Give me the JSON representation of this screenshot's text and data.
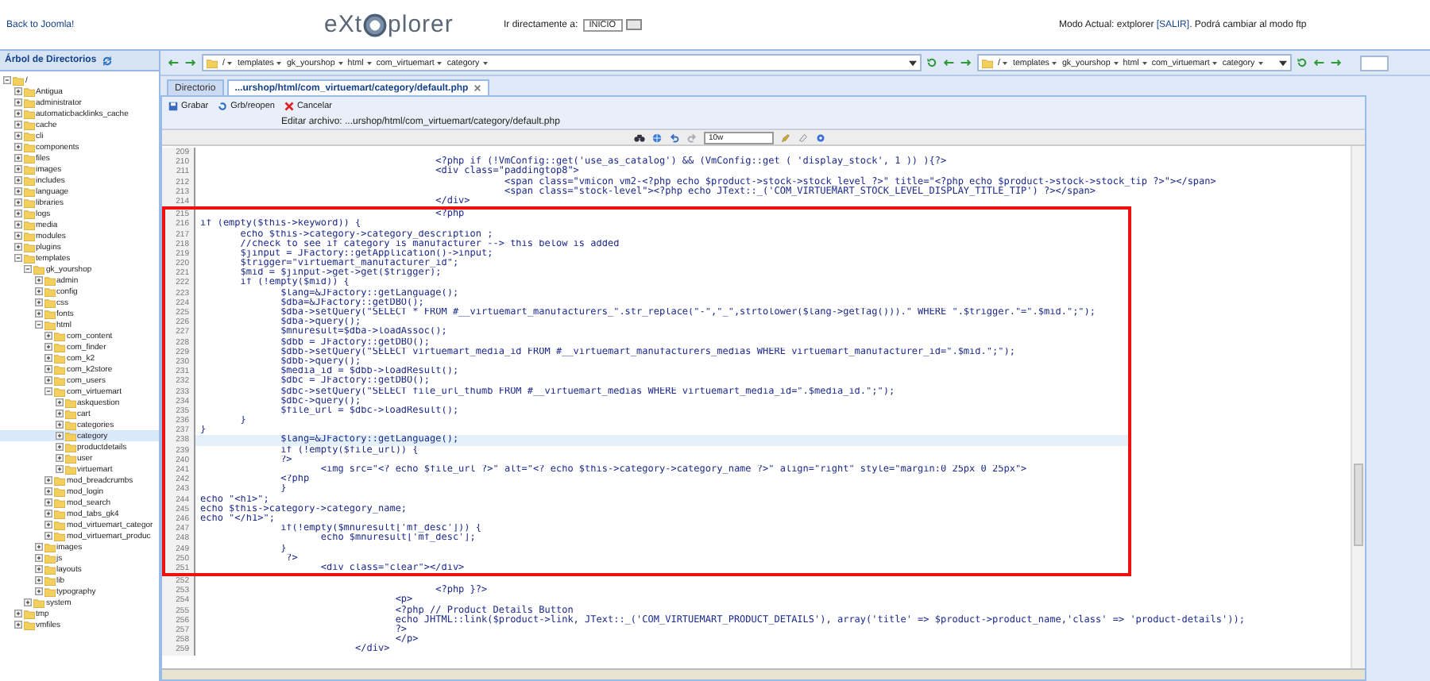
{
  "header": {
    "back_link": "Back to Joomla!",
    "logo": {
      "left": "eXt",
      "right": "plorer"
    },
    "goto_label": "Ir directamente a:",
    "goto_value": "INICIO",
    "mode_text": "Modo Actual: extplorer",
    "mode_link": "[SALIR]",
    "mode_tail": ". Podrá cambiar al modo ftp"
  },
  "sidebar": {
    "title": "Árbol de Directorios",
    "tree": [
      {
        "label": "/",
        "expanded": true,
        "selected": false,
        "children": [
          {
            "label": "Antigua",
            "expanded": false,
            "selected": false
          },
          {
            "label": "administrator",
            "expanded": false,
            "selected": false
          },
          {
            "label": "automaticbacklinks_cache",
            "expanded": false,
            "selected": false
          },
          {
            "label": "cache",
            "expanded": false,
            "selected": false
          },
          {
            "label": "cli",
            "expanded": false,
            "selected": false
          },
          {
            "label": "components",
            "expanded": false,
            "selected": false
          },
          {
            "label": "files",
            "expanded": false,
            "selected": false
          },
          {
            "label": "images",
            "expanded": false,
            "selected": false
          },
          {
            "label": "includes",
            "expanded": false,
            "selected": false
          },
          {
            "label": "language",
            "expanded": false,
            "selected": false
          },
          {
            "label": "libraries",
            "expanded": false,
            "selected": false
          },
          {
            "label": "logs",
            "expanded": false,
            "selected": false
          },
          {
            "label": "media",
            "expanded": false,
            "selected": false
          },
          {
            "label": "modules",
            "expanded": false,
            "selected": false
          },
          {
            "label": "plugins",
            "expanded": false,
            "selected": false
          },
          {
            "label": "templates",
            "expanded": true,
            "selected": false,
            "children": [
              {
                "label": "gk_yourshop",
                "expanded": true,
                "selected": false,
                "children": [
                  {
                    "label": "admin",
                    "expanded": false,
                    "selected": false
                  },
                  {
                    "label": "config",
                    "expanded": false,
                    "selected": false
                  },
                  {
                    "label": "css",
                    "expanded": false,
                    "selected": false
                  },
                  {
                    "label": "fonts",
                    "expanded": false,
                    "selected": false
                  },
                  {
                    "label": "html",
                    "expanded": true,
                    "selected": false,
                    "children": [
                      {
                        "label": "com_content",
                        "expanded": false,
                        "selected": false
                      },
                      {
                        "label": "com_finder",
                        "expanded": false,
                        "selected": false
                      },
                      {
                        "label": "com_k2",
                        "expanded": false,
                        "selected": false
                      },
                      {
                        "label": "com_k2store",
                        "expanded": false,
                        "selected": false
                      },
                      {
                        "label": "com_users",
                        "expanded": false,
                        "selected": false
                      },
                      {
                        "label": "com_virtuemart",
                        "expanded": true,
                        "selected": false,
                        "children": [
                          {
                            "label": "askquestion",
                            "expanded": false,
                            "selected": false
                          },
                          {
                            "label": "cart",
                            "expanded": false,
                            "selected": false
                          },
                          {
                            "label": "categories",
                            "expanded": false,
                            "selected": false
                          },
                          {
                            "label": "category",
                            "expanded": false,
                            "selected": true
                          },
                          {
                            "label": "productdetails",
                            "expanded": false,
                            "selected": false
                          },
                          {
                            "label": "user",
                            "expanded": false,
                            "selected": false
                          },
                          {
                            "label": "virtuemart",
                            "expanded": false,
                            "selected": false
                          }
                        ]
                      },
                      {
                        "label": "mod_breadcrumbs",
                        "expanded": false,
                        "selected": false
                      },
                      {
                        "label": "mod_login",
                        "expanded": false,
                        "selected": false
                      },
                      {
                        "label": "mod_search",
                        "expanded": false,
                        "selected": false
                      },
                      {
                        "label": "mod_tabs_gk4",
                        "expanded": false,
                        "selected": false
                      },
                      {
                        "label": "mod_virtuemart_categor",
                        "expanded": false,
                        "selected": false
                      },
                      {
                        "label": "mod_virtuemart_produc",
                        "expanded": false,
                        "selected": false
                      }
                    ]
                  },
                  {
                    "label": "images",
                    "expanded": false,
                    "selected": false
                  },
                  {
                    "label": "js",
                    "expanded": false,
                    "selected": false
                  },
                  {
                    "label": "layouts",
                    "expanded": false,
                    "selected": false
                  },
                  {
                    "label": "lib",
                    "expanded": false,
                    "selected": false
                  },
                  {
                    "label": "typography",
                    "expanded": false,
                    "selected": false
                  }
                ]
              },
              {
                "label": "system",
                "expanded": false,
                "selected": false
              }
            ]
          },
          {
            "label": "tmp",
            "expanded": false,
            "selected": false
          },
          {
            "label": "vmfiles",
            "expanded": false,
            "selected": false
          }
        ]
      }
    ]
  },
  "path_bars": [
    {
      "crumbs": [
        "/",
        "templates",
        "gk_yourshop",
        "html",
        "com_virtuemart",
        "category"
      ]
    },
    {
      "crumbs": [
        "/",
        "templates",
        "gk_yourshop",
        "html",
        "com_virtuemart",
        "category"
      ]
    }
  ],
  "tabs": [
    {
      "label": "Directorio",
      "selected": false
    },
    {
      "label": "...urshop/html/com_virtuemart/category/default.php",
      "selected": true
    }
  ],
  "toolbar": [
    "Grabar",
    "Grb/reopen",
    "Cancelar"
  ],
  "edit_title": "Editar archivo: ...urshop/html/com_virtuemart/category/default.php",
  "font_size": "10w",
  "annotation_frame": true,
  "code_lines": [
    {
      "number": "209",
      "current": false
    },
    {
      "number": "210",
      "code": "                                         <?php if (!VmConfig::get('use_as_catalog') && (VmConfig::get ( 'display_stock', 1 )) ){?>",
      "current": false
    },
    {
      "number": "211",
      "code": "                                         <div class=\"paddingtop8\">",
      "current": false
    },
    {
      "number": "212",
      "code": "                                                     <span class=\"vmicon vm2-<?php echo $product->stock->stock_level ?>\" title=\"<?php echo $product->stock->stock_tip ?>\"></span>",
      "current": false
    },
    {
      "number": "213",
      "code": "                                                     <span class=\"stock-level\"><?php echo JText::_('COM_VIRTUEMART_STOCK_LEVEL_DISPLAY_TITLE_TIP') ?></span>",
      "current": false
    },
    {
      "number": "214",
      "code": "                                         </div>",
      "current": false
    },
    {
      "number": "215",
      "code": "                                         <?php",
      "current": false
    },
    {
      "number": "216",
      "code": "if (empty($this->keyword)) {",
      "current": false
    },
    {
      "number": "217",
      "code": "       echo $this->category->category_description ;",
      "current": false
    },
    {
      "number": "218",
      "code": "       //check to see if category is manufacturer --> this below is added",
      "current": false
    },
    {
      "number": "219",
      "code": "       $jinput = JFactory::getApplication()->input;",
      "current": false
    },
    {
      "number": "220",
      "code": "       $trigger=\"virtuemart_manufacturer_id\";",
      "current": false
    },
    {
      "number": "221",
      "code": "       $mid = $jinput->get->get($trigger);",
      "current": false
    },
    {
      "number": "222",
      "code": "       if (!empty($mid)) {",
      "current": false
    },
    {
      "number": "223",
      "code": "              $lang=&JFactory::getLanguage();",
      "current": false
    },
    {
      "number": "224",
      "code": "              $dba=&JFactory::getDBO();",
      "current": false
    },
    {
      "number": "225",
      "code": "              $dba->setQuery(\"SELECT * FROM #__virtuemart_manufacturers_\".str_replace(\"-\",\"_\",strtolower($lang->getTag())).\" WHERE \".$trigger.\"=\".$mid.\";\");",
      "current": false
    },
    {
      "number": "226",
      "code": "              $dba->query();",
      "current": false
    },
    {
      "number": "227",
      "code": "              $mnuresult=$dba->loadAssoc();",
      "current": false
    },
    {
      "number": "228",
      "code": "              $dbb = JFactory::getDBO();",
      "current": false
    },
    {
      "number": "229",
      "code": "              $dbb->setQuery(\"SELECT virtuemart_media_id FROM #__virtuemart_manufacturers_medias WHERE virtuemart_manufacturer_id=\".$mid.\";\");",
      "current": false
    },
    {
      "number": "230",
      "code": "              $dbb->query();",
      "current": false
    },
    {
      "number": "231",
      "code": "              $media_id = $dbb->loadResult();",
      "current": false
    },
    {
      "number": "232",
      "code": "              $dbc = JFactory::getDBO();",
      "current": false
    },
    {
      "number": "233",
      "code": "              $dbc->setQuery(\"SELECT file_url_thumb FROM #__virtuemart_medias WHERE virtuemart_media_id=\".$media_id.\";\");",
      "current": false
    },
    {
      "number": "234",
      "code": "              $dbc->query();",
      "current": false
    },
    {
      "number": "235",
      "code": "              $file_url = $dbc->loadResult();",
      "current": false
    },
    {
      "number": "236",
      "code": "       }",
      "current": false
    },
    {
      "number": "237",
      "code": "}",
      "current": false
    },
    {
      "number": "238",
      "code": "              $lang=&JFactory::getLanguage();",
      "current": true
    },
    {
      "number": "239",
      "code": "              if (!empty($file_url)) {",
      "current": false
    },
    {
      "number": "240",
      "code": "              ?>",
      "current": false
    },
    {
      "number": "241",
      "code": "                     <img src=\"<? echo $file_url ?>\" alt=\"<? echo $this->category->category_name ?>\" align=\"right\" style=\"margin:0 25px 0 25px\">",
      "current": false
    },
    {
      "number": "242",
      "code": "              <?php",
      "current": false
    },
    {
      "number": "243",
      "code": "              }",
      "current": false
    },
    {
      "number": "244",
      "code": "echo \"<h1>\";",
      "current": false
    },
    {
      "number": "245",
      "code": "echo $this->category->category_name;",
      "current": false
    },
    {
      "number": "246",
      "code": "echo \"</h1>\";",
      "current": false
    },
    {
      "number": "247",
      "code": "              if(!empty($mnuresult['mf_desc'])) {",
      "current": false
    },
    {
      "number": "248",
      "code": "                     echo $mnuresult['mf_desc'];",
      "current": false
    },
    {
      "number": "249",
      "code": "              }",
      "current": false
    },
    {
      "number": "250",
      "code": "               ?>",
      "current": false
    },
    {
      "number": "251",
      "code": "                     <div class=\"clear\"></div>",
      "current": false
    },
    {
      "number": "252",
      "current": false
    },
    {
      "number": "253",
      "code": "                                         <?php }?>",
      "current": false
    },
    {
      "number": "254",
      "code": "                                  <p>",
      "current": false
    },
    {
      "number": "255",
      "code": "                                  <?php // Product Details Button",
      "current": false
    },
    {
      "number": "256",
      "code": "                                  echo JHTML::link($product->link, JText::_('COM_VIRTUEMART_PRODUCT_DETAILS'), array('title' => $product->product_name,'class' => 'product-details'));",
      "current": false
    },
    {
      "number": "257",
      "code": "                                  ?>",
      "current": false
    },
    {
      "number": "258",
      "code": "                                  </p>",
      "current": false
    },
    {
      "number": "259",
      "code": "                           </div>",
      "current": false
    }
  ]
}
